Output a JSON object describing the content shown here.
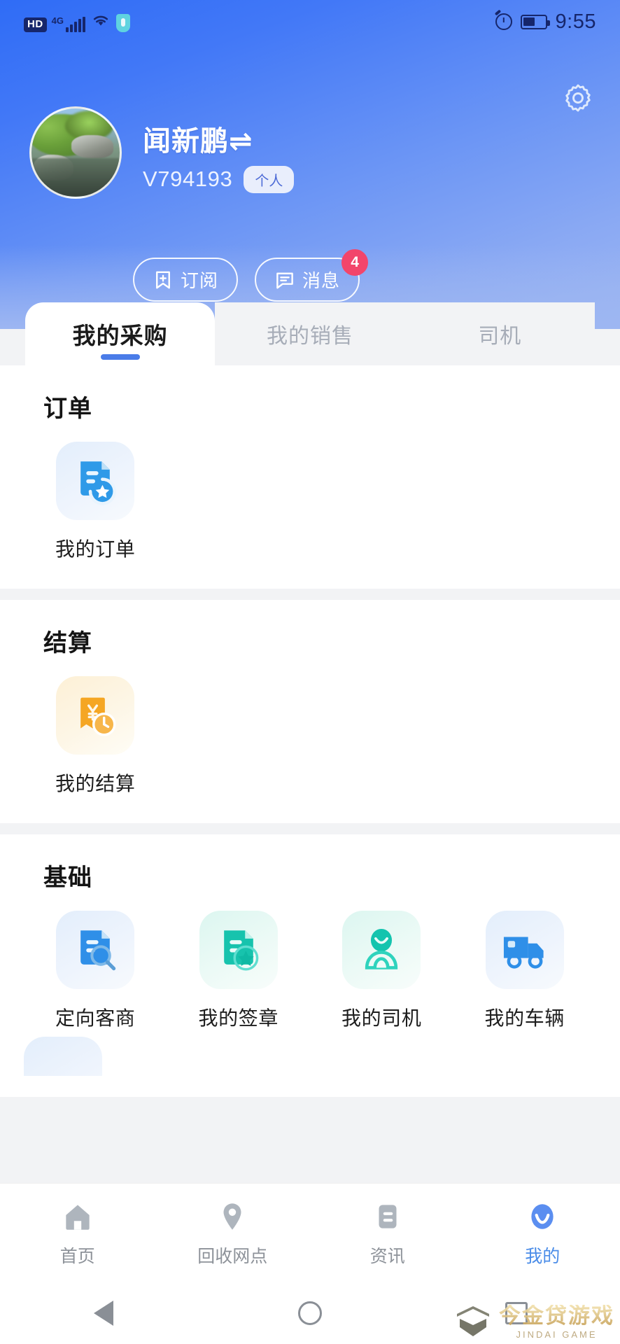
{
  "statusbar": {
    "hd": "HD",
    "network": "4G",
    "time": "9:55",
    "icons": [
      "hd-badge",
      "signal-bars",
      "wifi-icon",
      "shield-icon",
      "alarm-icon",
      "battery-icon"
    ]
  },
  "header": {
    "settings_icon": "gear-icon",
    "avatar_alt": "avatar",
    "name": "闻新鹏",
    "switch_icon": "⇌",
    "user_id": "V794193",
    "account_type_tag": "个人",
    "actions": [
      {
        "label": "订阅",
        "icon": "bookmark-plus-icon",
        "badge": ""
      },
      {
        "label": "消息",
        "icon": "message-icon",
        "badge": "4"
      }
    ]
  },
  "tabs": [
    {
      "label": "我的采购",
      "active": true
    },
    {
      "label": "我的销售",
      "active": false
    },
    {
      "label": "司机",
      "active": false
    }
  ],
  "sections": [
    {
      "title": "订单",
      "items": [
        {
          "label": "我的订单",
          "icon": "document-star-icon",
          "tone": "blue"
        }
      ]
    },
    {
      "title": "结算",
      "items": [
        {
          "label": "我的结算",
          "icon": "yuan-clock-icon",
          "tone": "orange"
        }
      ]
    },
    {
      "title": "基础",
      "items": [
        {
          "label": "定向客商",
          "icon": "document-search-icon",
          "tone": "blue"
        },
        {
          "label": "我的签章",
          "icon": "document-seal-icon",
          "tone": "teal"
        },
        {
          "label": "我的司机",
          "icon": "driver-person-icon",
          "tone": "teal"
        },
        {
          "label": "我的车辆",
          "icon": "truck-icon",
          "tone": "blue"
        }
      ]
    }
  ],
  "bottom_nav": [
    {
      "label": "首页",
      "icon": "home-icon",
      "active": false
    },
    {
      "label": "回收网点",
      "icon": "location-pin-icon",
      "active": false
    },
    {
      "label": "资讯",
      "icon": "news-icon",
      "active": false
    },
    {
      "label": "我的",
      "icon": "profile-smiley-icon",
      "active": true
    }
  ],
  "android_nav": [
    {
      "name": "back-button",
      "icon": "triangle-back-icon"
    },
    {
      "name": "home-button",
      "icon": "circle-home-icon"
    },
    {
      "name": "recents-button",
      "icon": "square-recents-icon"
    }
  ],
  "watermark": {
    "cn": "今金贷游戏",
    "en": "JINDAI GAME",
    "logo": "hexagon-logo-icon"
  },
  "colors": {
    "header_gradient_start": "#2f6cf6",
    "header_gradient_end": "#9db6f2",
    "accent": "#4a7ce8",
    "badge_red": "#f2456b",
    "active_nav": "#4a8ce8",
    "icon_blue": "#3d9ce8",
    "icon_orange": "#f2a33c",
    "icon_teal": "#1fc8b0"
  }
}
